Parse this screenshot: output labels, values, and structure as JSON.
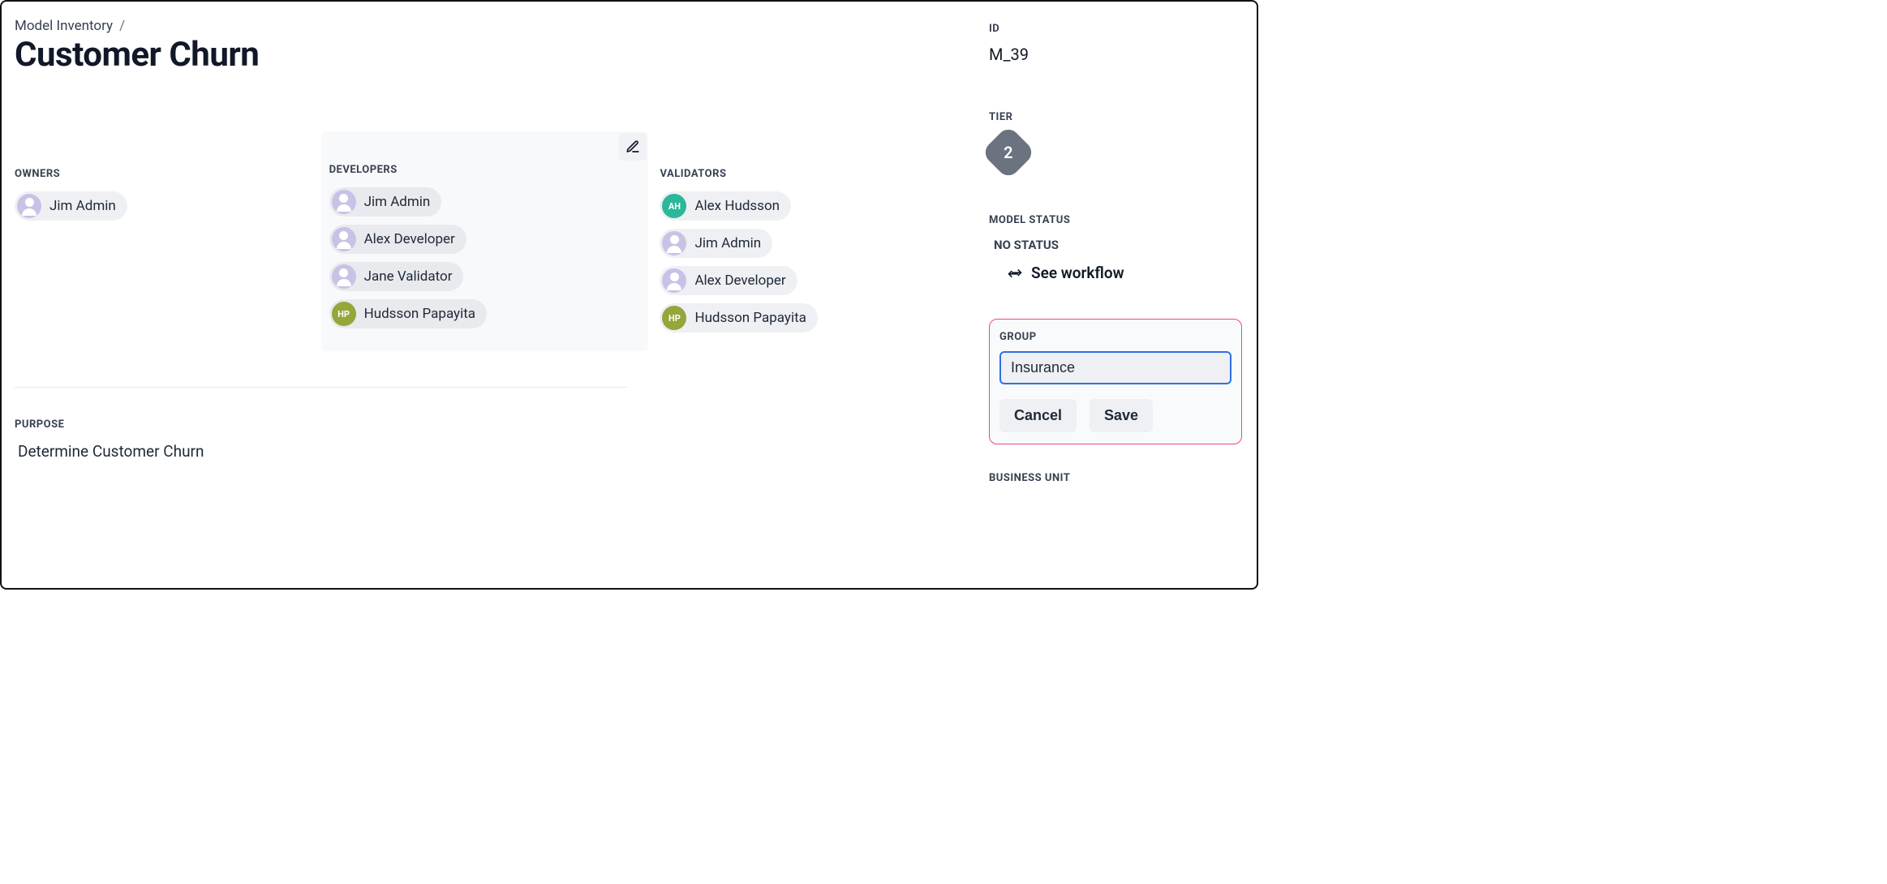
{
  "breadcrumb": {
    "parent": "Model Inventory",
    "sep": "/"
  },
  "title": "Customer Churn",
  "roles": {
    "owners_label": "OWNERS",
    "developers_label": "DEVELOPERS",
    "validators_label": "VALIDATORS",
    "owners": [
      {
        "name": "Jim Admin",
        "avatar_type": "ghost",
        "initials": ""
      }
    ],
    "developers": [
      {
        "name": "Jim Admin",
        "avatar_type": "ghost",
        "initials": ""
      },
      {
        "name": "Alex Developer",
        "avatar_type": "ghost",
        "initials": ""
      },
      {
        "name": "Jane Validator",
        "avatar_type": "ghost",
        "initials": ""
      },
      {
        "name": "Hudsson Papayita",
        "avatar_type": "olive",
        "initials": "HP"
      }
    ],
    "validators": [
      {
        "name": "Alex Hudsson",
        "avatar_type": "teal",
        "initials": "AH"
      },
      {
        "name": "Jim Admin",
        "avatar_type": "ghost",
        "initials": ""
      },
      {
        "name": "Alex Developer",
        "avatar_type": "ghost",
        "initials": ""
      },
      {
        "name": "Hudsson Papayita",
        "avatar_type": "olive",
        "initials": "HP"
      }
    ]
  },
  "purpose": {
    "label": "PURPOSE",
    "value": "Determine Customer Churn"
  },
  "meta": {
    "id_label": "ID",
    "id_value": "M_39",
    "tier_label": "TIER",
    "tier_value": "2",
    "status_label": "MODEL STATUS",
    "status_value": "NO STATUS",
    "see_workflow": "See workflow",
    "group_label": "GROUP",
    "group_value": "Insurance",
    "cancel": "Cancel",
    "save": "Save",
    "business_unit_label": "BUSINESS UNIT"
  }
}
